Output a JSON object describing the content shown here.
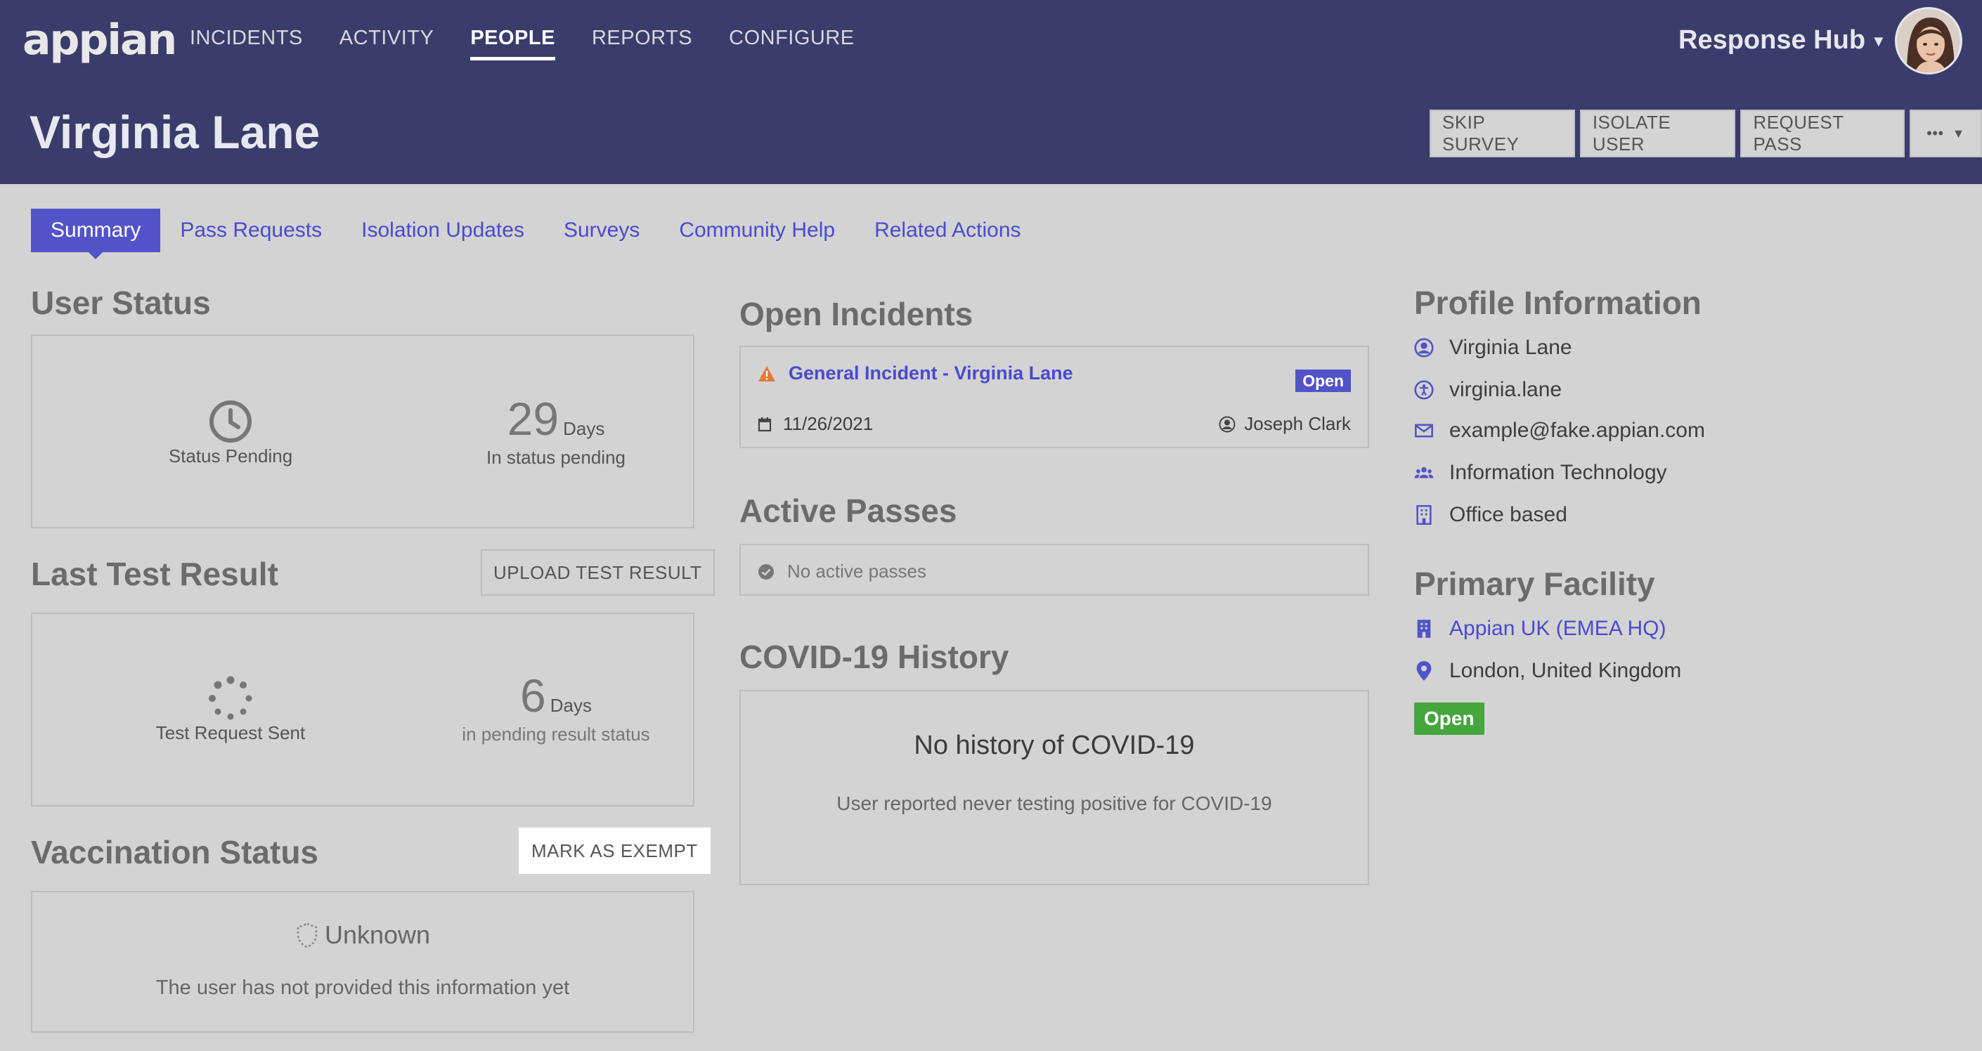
{
  "app": {
    "logo_text": "appian",
    "nav": [
      "INCIDENTS",
      "ACTIVITY",
      "PEOPLE",
      "REPORTS",
      "CONFIGURE"
    ],
    "active_nav": "PEOPLE",
    "hub_label": "Response Hub"
  },
  "page": {
    "title": "Virginia Lane",
    "actions": [
      "SKIP SURVEY",
      "ISOLATE USER",
      "REQUEST PASS"
    ],
    "more_label": "•••"
  },
  "tabs": [
    "Summary",
    "Pass Requests",
    "Isolation Updates",
    "Surveys",
    "Community Help",
    "Related Actions"
  ],
  "user_status": {
    "title": "User Status",
    "status_label": "Status Pending",
    "days_value": "29",
    "days_unit": "Days",
    "days_caption": "In status pending"
  },
  "last_test": {
    "title": "Last Test Result",
    "upload_label": "UPLOAD TEST RESULT",
    "status_label": "Test Request Sent",
    "days_value": "6",
    "days_unit": "Days",
    "days_caption": "in pending result status"
  },
  "vaccination": {
    "title": "Vaccination Status",
    "exempt_label": "MARK AS EXEMPT",
    "status": "Unknown",
    "note": "The user has not provided this information yet"
  },
  "open_incidents": {
    "title": "Open Incidents",
    "incident_name": "General Incident - Virginia Lane",
    "status_badge": "Open",
    "date": "11/26/2021",
    "owner": "Joseph Clark"
  },
  "active_passes": {
    "title": "Active Passes",
    "empty_text": "No active passes"
  },
  "covid_history": {
    "title": "COVID-19 History",
    "heading": "No history of COVID-19",
    "note": "User reported never testing positive for COVID-19"
  },
  "profile": {
    "title": "Profile Information",
    "name": "Virginia Lane",
    "username": "virginia.lane",
    "email": "example@fake.appian.com",
    "department": "Information Technology",
    "work_mode": "Office based"
  },
  "facility": {
    "title": "Primary Facility",
    "name": "Appian UK (EMEA HQ)",
    "location": "London, United Kingdom",
    "status": "Open"
  },
  "colors": {
    "header_bg": "#3a3c6b",
    "accent": "#5253c8",
    "link": "#4a4ad0",
    "open_green": "#44a63b",
    "warning_orange": "#e07b39"
  }
}
